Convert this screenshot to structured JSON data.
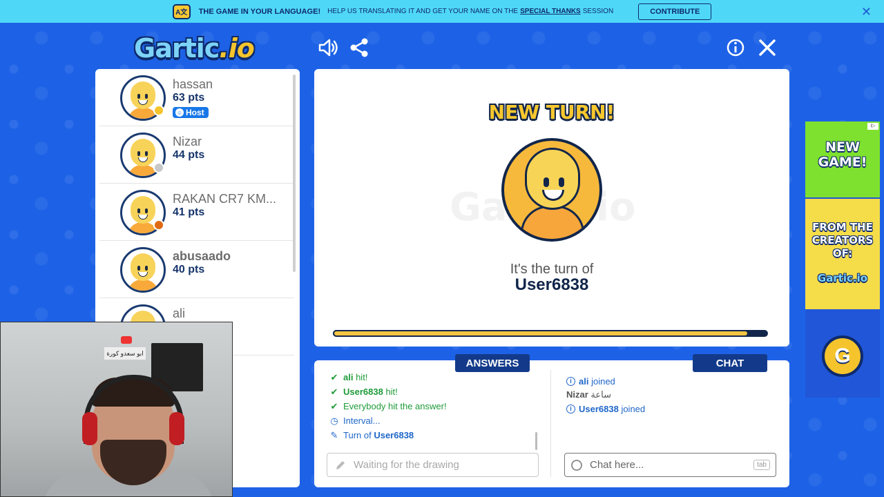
{
  "banner": {
    "title": "THE GAME IN YOUR LANGUAGE!",
    "subtitle": "HELP US TRANSLATING IT AND GET YOUR NAME ON THE",
    "link": "SPECIAL THANKS",
    "after_link": "SESSION",
    "contribute_label": "CONTRIBUTE",
    "close_glyph": "✕"
  },
  "header": {
    "logo_main": "Gartic",
    "logo_suffix": ".io",
    "icons": [
      "volume-icon",
      "share-icon",
      "info-icon",
      "close-icon"
    ]
  },
  "players": [
    {
      "name": "hassan",
      "points": "63 pts",
      "status_color": "#f5c42c",
      "host": true,
      "name_bold": false
    },
    {
      "name": "Nizar",
      "points": "44 pts",
      "status_color": "#c8c8c8",
      "host": false,
      "name_bold": false
    },
    {
      "name": "RAKAN CR7 KM...",
      "points": "41 pts",
      "status_color": "#e06a14",
      "host": false,
      "name_bold": false
    },
    {
      "name": "abusaado",
      "points": "40 pts",
      "status_color": "",
      "host": false,
      "name_bold": true
    },
    {
      "name": "ali",
      "points": "",
      "status_color": "",
      "host": false,
      "name_bold": false
    }
  ],
  "host_label": "Host",
  "canvas": {
    "heading": "NEW TURN!",
    "watermark": "Gartic.io",
    "turn_text": "It's the turn of",
    "turn_user": "User6838",
    "progress_fraction": 0.955
  },
  "answers": {
    "tab_label": "ANSWERS",
    "rows": [
      {
        "icon": "check",
        "name": "ali",
        "text": " hit!"
      },
      {
        "icon": "check",
        "name": "User6838",
        "text": " hit!"
      },
      {
        "icon": "check",
        "name": "",
        "text": "Everybody hit the answer!"
      },
      {
        "icon": "clock",
        "name": "",
        "text": "Interval..."
      },
      {
        "icon": "pencil",
        "name": "User6838",
        "text": "Turn of "
      }
    ],
    "input_placeholder": "Waiting for the drawing"
  },
  "chat": {
    "tab_label": "CHAT",
    "rows": [
      {
        "type": "info",
        "name": "ali",
        "text": " joined"
      },
      {
        "type": "msg",
        "name": "Nizar",
        "text": " ساعة"
      },
      {
        "type": "info",
        "name": "User6838",
        "text": " joined"
      }
    ],
    "input_placeholder": "Chat here...",
    "tab_key": "tab"
  },
  "ad": {
    "line1": "NEW GAME!",
    "line2": "FROM THE CREATORS OF:",
    "brand": "Gartic.io",
    "button_glyph": "G",
    "adchoice": "i▷"
  },
  "webcam": {
    "sign_text": "ابو سعدو كورة"
  }
}
